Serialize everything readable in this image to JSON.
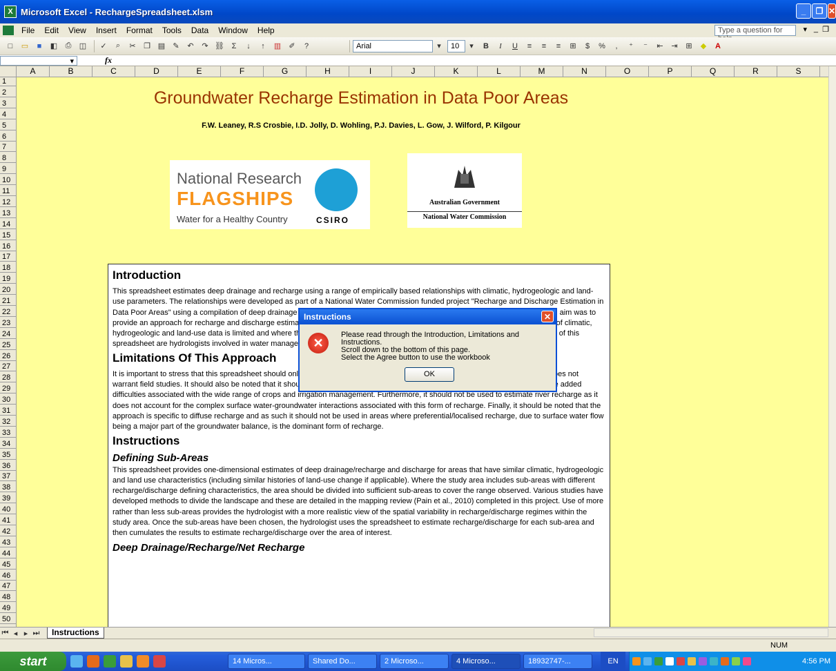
{
  "window": {
    "title": "Microsoft Excel - RechargeSpreadsheet.xlsm",
    "minimize": "_",
    "restore": "❐",
    "close": "✕"
  },
  "menu": {
    "items": [
      "File",
      "Edit",
      "View",
      "Insert",
      "Format",
      "Tools",
      "Data",
      "Window",
      "Help"
    ],
    "help_placeholder": "Type a question for help"
  },
  "toolbar": {
    "font_name": "Arial",
    "font_size": "10",
    "bold": "B",
    "italic": "I",
    "underline": "U",
    "currency": "$",
    "percent": "%"
  },
  "formula": {
    "fx": "fx",
    "namebox": ""
  },
  "columns": [
    "A",
    "B",
    "C",
    "D",
    "E",
    "F",
    "G",
    "H",
    "I",
    "J",
    "K",
    "L",
    "M",
    "N",
    "O",
    "P",
    "Q",
    "R",
    "S"
  ],
  "rows": [
    "1",
    "2",
    "3",
    "4",
    "5",
    "6",
    "7",
    "8",
    "9",
    "10",
    "11",
    "12",
    "13",
    "14",
    "15",
    "16",
    "17",
    "18",
    "19",
    "20",
    "21",
    "22",
    "23",
    "24",
    "25",
    "26",
    "27",
    "28",
    "29",
    "30",
    "31",
    "32",
    "33",
    "34",
    "35",
    "36",
    "37",
    "38",
    "39",
    "40",
    "41",
    "42",
    "43",
    "44",
    "45",
    "46",
    "47",
    "48",
    "49",
    "50"
  ],
  "sheet": {
    "title": "Groundwater Recharge Estimation in Data Poor Areas",
    "authors": "F.W. Leaney, R.S Crosbie, I.D. Jolly, D. Wohling, P.J. Davies, L. Gow, J. Wilford, P. Kilgour",
    "logo_left": {
      "line1": "National Research",
      "line2": "FLAGSHIPS",
      "line3": "Water for a Healthy Country",
      "brand": "CSIRO"
    },
    "logo_right": {
      "line1": "Australian Government",
      "line2": "National Water Commission"
    },
    "intro_heading": "Introduction",
    "intro_text": "This spreadsheet estimates deep drainage and recharge using a range of empirically based relationships with climatic, hydrogeologic and land-use parameters. The relationships were developed as part of a National Water Commission funded project \"Recharge and Discharge Estimation in Data Poor Areas\" using a compilation of deep drainage and recharge measurements made in Australia (Crosbie et al., 2010a,b). The aim was to provide an approach for recharge and discharge estimation that can be used in most Australian environments, where the availability of climatic, hydrogeologic and land-use data is limited and where there have been no or few field-based studies undertaken. The intended users of this spreadsheet are hydrologists involved in water management.",
    "limit_heading": "Limitations Of This Approach",
    "limit_text": "It is important to stress that this spreadsheet should only be used in data poor areas where the value of the groundwater resource does not warrant field studies. It should also be noted that it should not be used in irrigation areas because the methods do not account for the added difficulties associated with the wide range of crops and irrigation management. Furthermore, it should not be used to estimate river recharge as it does not account for the complex surface water-groundwater interactions associated with this form of recharge. Finally, it should be noted that the approach is specific to diffuse recharge and as such it should not be used in areas where preferential/localised recharge, due to surface water flow being a major part of the groundwater balance, is the dominant form of recharge.",
    "instr_heading": "Instructions",
    "subareas_heading": "Defining Sub-Areas",
    "subareas_text": "This spreadsheet provides one-dimensional estimates of deep drainage/recharge and discharge for areas that have similar climatic, hydrogeologic and land use characteristics (including similar histories  of land-use change if applicable). Where the study area includes sub-areas with different recharge/discharge defining characteristics, the area should be divided into sufficient sub-areas to cover the range observed. Various studies have developed methods to divide the landscape and these are detailed in the mapping review (Pain et al., 2010) completed in this project. Use of more rather than less sub-areas provides the hydrologist with a more realistic view of the spatial variability in recharge/discharge regimes within the study area. Once the sub-areas have been chosen, the hydrologist uses the spreadsheet to estimate recharge/discharge for each sub-area and then cumulates the results to estimate recharge/discharge over the area of interest.",
    "deep_heading": "Deep Drainage/Recharge/Net Recharge"
  },
  "dialog": {
    "title": "Instructions",
    "line1": "Please read through the Introduction, Limitations and Instructions.",
    "line2": "Scroll down to the bottom of this page.",
    "line3": "Select the Agree button to use the workbook",
    "ok": "OK",
    "close": "✕"
  },
  "tabs": {
    "active": "Instructions"
  },
  "status": {
    "num": "NUM"
  },
  "taskbar": {
    "start": "start",
    "buttons": [
      "14 Micros...",
      "Shared Do...",
      "2 Microso...",
      "4 Microso...",
      "18932747-..."
    ],
    "lang": "EN",
    "clock": "4:56 PM"
  }
}
